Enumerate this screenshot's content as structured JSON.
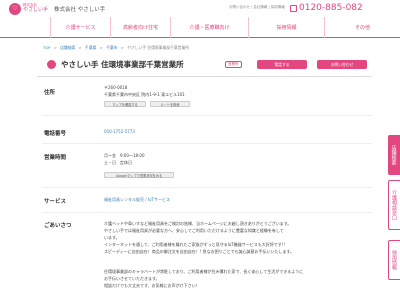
{
  "header": {
    "logo_text": "やさしい手",
    "logo_sub": "株式会社",
    "company": "株式会社 やさしい手",
    "links": "お問い合わせ | 会社情報 | 採用情報",
    "phone": "0120-885-082"
  },
  "nav": {
    "items": [
      "介護サービス",
      "高齢者向け住宅",
      "介護・医療職向け",
      "採用情報",
      "その他"
    ]
  },
  "breadcrumb": [
    "TOP",
    ">",
    "店舗検索",
    ">",
    "千葉県",
    ">",
    "千葉市",
    ">",
    "やさしい手 住環境事業部千葉営業所"
  ],
  "page": {
    "title": "やさしい手 住環境事業部千葉営業所",
    "badge": "営業所",
    "btn_call": "電話する",
    "btn_contact": "お問い合わせ"
  },
  "address": {
    "label": "住所",
    "zip": "〒260-0018",
    "line": "千葉県千葉市中央区 院内1-9-1 東エビル101",
    "btn_map": "マップを確認する",
    "btn_route": "ルートを検索"
  },
  "phone": {
    "label": "電話番号",
    "value": "050-1752-5773"
  },
  "hours": {
    "label": "営業時間",
    "line1": "月〜金　9:00〜18:00",
    "line2": "土・日　定休日",
    "btn": "Googleマップで営業状況をみる"
  },
  "service": {
    "label": "サービス",
    "value": "福祉用具レンタル販売 / IoTサービス"
  },
  "greeting": {
    "label": "ごあいさつ",
    "lines": [
      "介護ベッドや車いすなど福祉用具をご検討の皆様、当ホームページにお越し頂きありがとうございます。",
      "やさしい手では福祉用具が必要な方へ、安心してご利用いただけるように豊富な知識と経験を有して",
      "います。",
      "インターネットを通して、ご利用者様を離れたご家族がずっと見守るIoT機器サービスも大好評です!!",
      "スピーディーに自由自在！商品の御注文を自由自在！! 急なお困りごとでも誠心誠意お手伝いいたします。",
      "",
      "住環境事業部のキャラバートが常駐しており、ご利用者様が住み慣れた家で、長く安心して生活ができるように",
      "お手伝いさせていただきます。",
      "相談だけでも大丈夫です、お気軽にお声がけ下さい！"
    ]
  },
  "side_tabs": [
    "店舗検索",
    "介護相談窓口",
    "採用情報"
  ],
  "colors": {
    "accent": "#e3477f",
    "link": "#3a7fb5"
  }
}
